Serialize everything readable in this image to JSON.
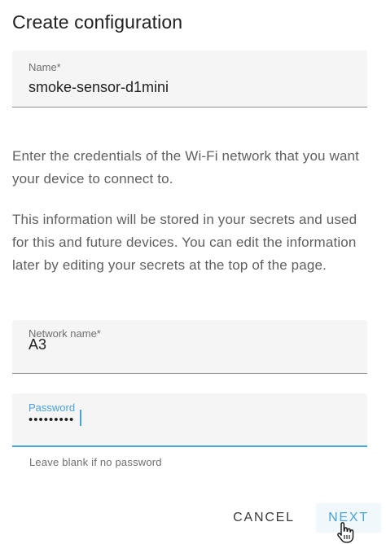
{
  "dialog": {
    "title": "Create configuration",
    "name_field": {
      "label": "Name*",
      "value": "smoke-sensor-d1mini"
    },
    "paragraph_1": "Enter the credentials of the Wi-Fi network that you want your device to connect to.",
    "paragraph_2": "This information will be stored in your secrets and used for this and future devices. You can edit the information later by editing your secrets at the top of the page.",
    "network_field": {
      "label": "Network name*",
      "value": "A3"
    },
    "password_field": {
      "label": "Password",
      "value_masked": "•••••••••",
      "helper": "Leave blank if no password"
    },
    "buttons": {
      "cancel": "CANCEL",
      "next": "NEXT"
    },
    "colors": {
      "accent": "#4ba3d9",
      "field_bg": "#f5f5f5",
      "text_secondary": "#5f5f5f"
    },
    "icons": {
      "cursor": "hand-pointer-icon"
    }
  }
}
